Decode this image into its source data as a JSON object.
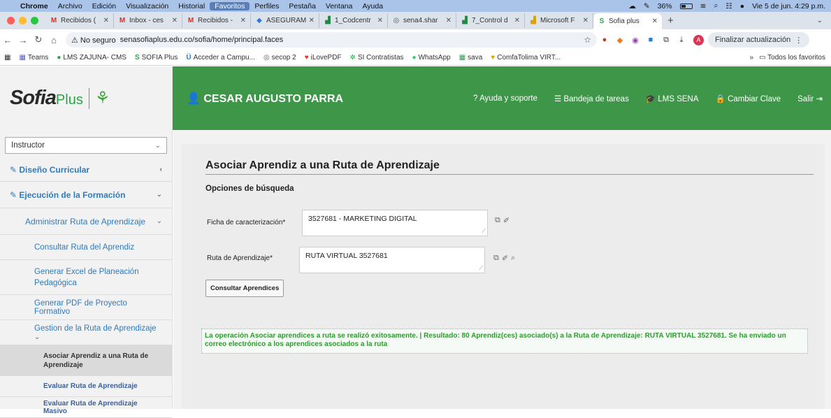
{
  "menubar": {
    "app": "Chrome",
    "items": [
      "Archivo",
      "Edición",
      "Visualización",
      "Historial",
      "Favoritos",
      "Perfiles",
      "Pestaña",
      "Ventana",
      "Ayuda"
    ],
    "battery": "36%",
    "clock": "Vie 5 de jun. 4:29 p.m."
  },
  "tabs": [
    {
      "icon": "M",
      "label": "Recibidos (",
      "color": "#d93025"
    },
    {
      "icon": "M",
      "label": "Inbox - ces",
      "color": "#d93025"
    },
    {
      "icon": "M",
      "label": "Recibidos -",
      "color": "#d93025"
    },
    {
      "icon": "◆",
      "label": "ASEGURAM",
      "color": "#2b7bd6"
    },
    {
      "icon": "▟",
      "label": "1_Codcentr",
      "color": "#1f8a45"
    },
    {
      "icon": "◎",
      "label": "sena4.shar",
      "color": "#555"
    },
    {
      "icon": "▟",
      "label": "7_Control d",
      "color": "#1f8a45"
    },
    {
      "icon": "▟",
      "label": "Microsoft F",
      "color": "#e0a100"
    },
    {
      "icon": "S",
      "label": "Sofia plus",
      "color": "#2aa34a"
    }
  ],
  "address": {
    "security": "⚠ No seguro",
    "url": "senasofiaplus.edu.co/sofia/home/principal.faces",
    "profile_initial": "A",
    "update_label": "Finalizar actualización"
  },
  "bookmarks": [
    {
      "icon": "▦",
      "label": "Teams"
    },
    {
      "icon": "●",
      "label": "LMS ZAJUNA- CMS"
    },
    {
      "icon": "S",
      "label": "SOFIA Plus"
    },
    {
      "icon": "Ü",
      "label": "Acceder a Campu..."
    },
    {
      "icon": "◎",
      "label": "secop 2"
    },
    {
      "icon": "♥",
      "label": "iLovePDF"
    },
    {
      "icon": "✲",
      "label": "SI Contratistas"
    },
    {
      "icon": "●",
      "label": "WhatsApp"
    },
    {
      "icon": "▦",
      "label": "sava"
    },
    {
      "icon": "♥",
      "label": "ComfaTolima VIRT..."
    }
  ],
  "bookmarks_more": "»",
  "bookmarks_all": "Todos los favoritos",
  "header": {
    "logo_main": "Sofia",
    "logo_plus": "Plus",
    "sena_mark": "⚘",
    "user": "CESAR AUGUSTO PARRA",
    "nav": [
      {
        "icon": "?",
        "label": "Ayuda y soporte"
      },
      {
        "icon": "☰",
        "label": "Bandeja de tareas"
      },
      {
        "icon": "🎓",
        "label": "LMS SENA"
      },
      {
        "icon": "🔒",
        "label": "Cambiar Clave"
      },
      {
        "icon": "⇥",
        "label": "Salir"
      }
    ]
  },
  "sidebar": {
    "role": "Instructor",
    "diseno": "Diseño Curricular",
    "ejecucion": "Ejecución de la Formación",
    "administrar": "Administrar Ruta de Aprendizaje",
    "consultar": "Consultar Ruta del Aprendiz",
    "excel": "Generar Excel de Planeación Pedagógica",
    "pdf": "Generar PDF de Proyecto Formativo",
    "gestion": "Gestion de la Ruta de Aprendizaje",
    "asociar": "Asociar Aprendiz a una Ruta de Aprendizaje",
    "evaluar": "Evaluar Ruta de Aprendizaje",
    "evaluar_masivo": "Evaluar Ruta de Aprendizaje Masivo"
  },
  "form": {
    "title": "Asociar Aprendiz a una Ruta de Aprendizaje",
    "section": "Opciones de búsqueda",
    "ficha_label": "Ficha de caracterización*",
    "ficha_value": "3527681 - MARKETING  DIGITAL",
    "ruta_label": "Ruta de Aprendizaje*",
    "ruta_value": "RUTA VIRTUAL 3527681",
    "button": "Consultar Aprendices",
    "success": "La operación Asociar aprendices a ruta se realizó exitosamente. | Resultado: 80 Aprendiz(ces) asociado(s) a la Ruta de Aprendizaje: RUTA VIRTUAL 3527681. Se ha enviado un correo electrónico a los aprendices asociados a la ruta"
  },
  "colors": {
    "brand_green": "#3e9748",
    "link_blue": "#2e7bbf",
    "success_green": "#2e9a2e"
  }
}
